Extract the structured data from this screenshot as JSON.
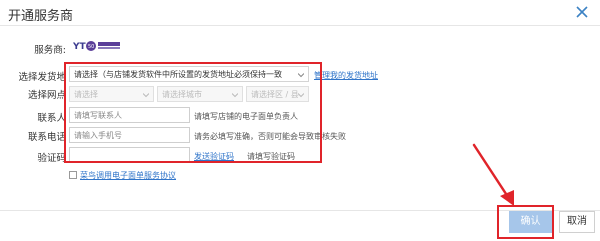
{
  "dialog": {
    "title": "开通服务商"
  },
  "form": {
    "provider_label": "服务商:",
    "address_label": "选择发货地",
    "address_select": "请选择（与店铺发货软件中所设置的发货地址必须保持一致",
    "manage_address_link": "管理我的发货地址",
    "outlet_label": "选择网点",
    "outlet_province": "请选择",
    "outlet_city": "请选择城市",
    "outlet_district": "请选择区 / 县",
    "contact_label": "联系人",
    "contact_placeholder": "请填写联系人",
    "contact_hint": "请填写店铺的电子面单负责人",
    "phone_label": "联系电话",
    "phone_placeholder": "请输入手机号",
    "phone_hint": "请务必填写准确，否则可能会导致审核失败",
    "code_label": "验证码",
    "send_code_link": "发送验证码",
    "code_hint": "请填写验证码",
    "agreement_link": "菜鸟调用电子面单服务协议"
  },
  "buttons": {
    "confirm": "确认",
    "cancel": "取消"
  },
  "colors": {
    "highlight": "#e0242a",
    "link": "#2f74c9",
    "confirm_bg": "#a6c6ea"
  }
}
